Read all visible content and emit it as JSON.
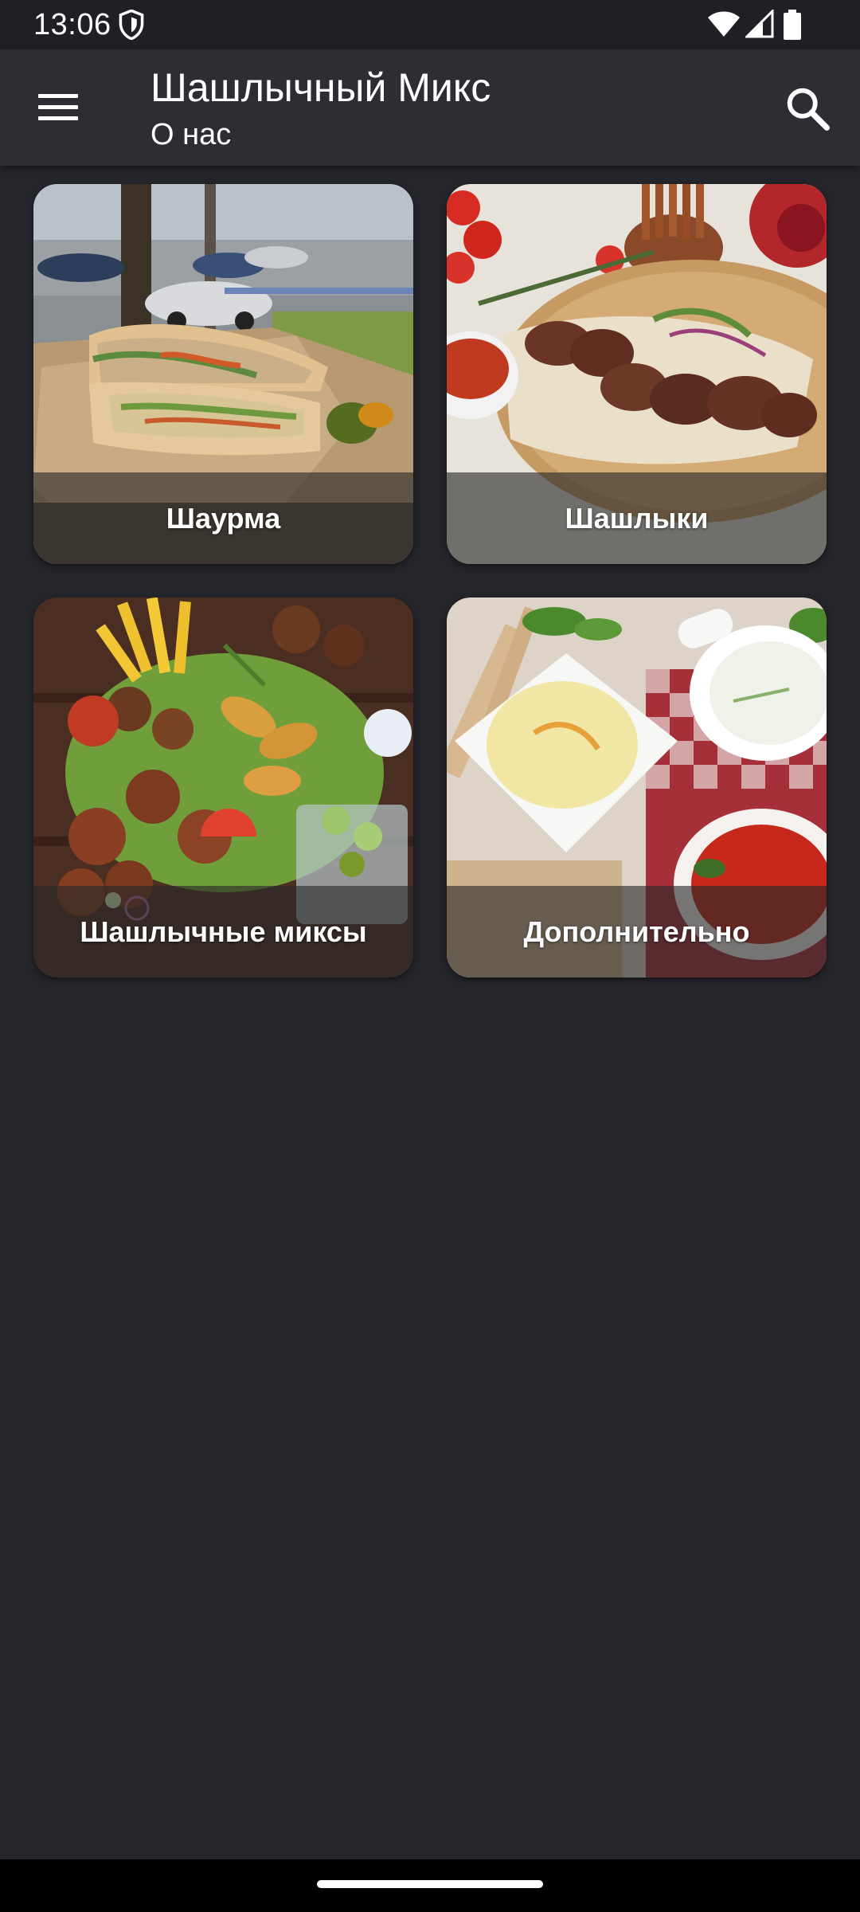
{
  "status_bar": {
    "time": "13:06",
    "icons": [
      "shield-icon",
      "wifi-icon",
      "signal-icon",
      "battery-icon"
    ]
  },
  "app_bar": {
    "title": "Шашлычный Микс",
    "subtitle": "О нас",
    "menu_icon": "menu-icon",
    "search_icon": "search-icon"
  },
  "categories": [
    {
      "label": "Шаурма",
      "image": "shawarma-photo"
    },
    {
      "label": "Шашлыки",
      "image": "shashlik-photo"
    },
    {
      "label": "Шашлычные миксы",
      "image": "shashlik-mix-photo"
    },
    {
      "label": "Дополнительно",
      "image": "sauces-photo"
    }
  ],
  "colors": {
    "background": "#25262c",
    "app_bar": "#2d2e34",
    "status_bar": "#1f2025",
    "text": "#ffffff"
  }
}
